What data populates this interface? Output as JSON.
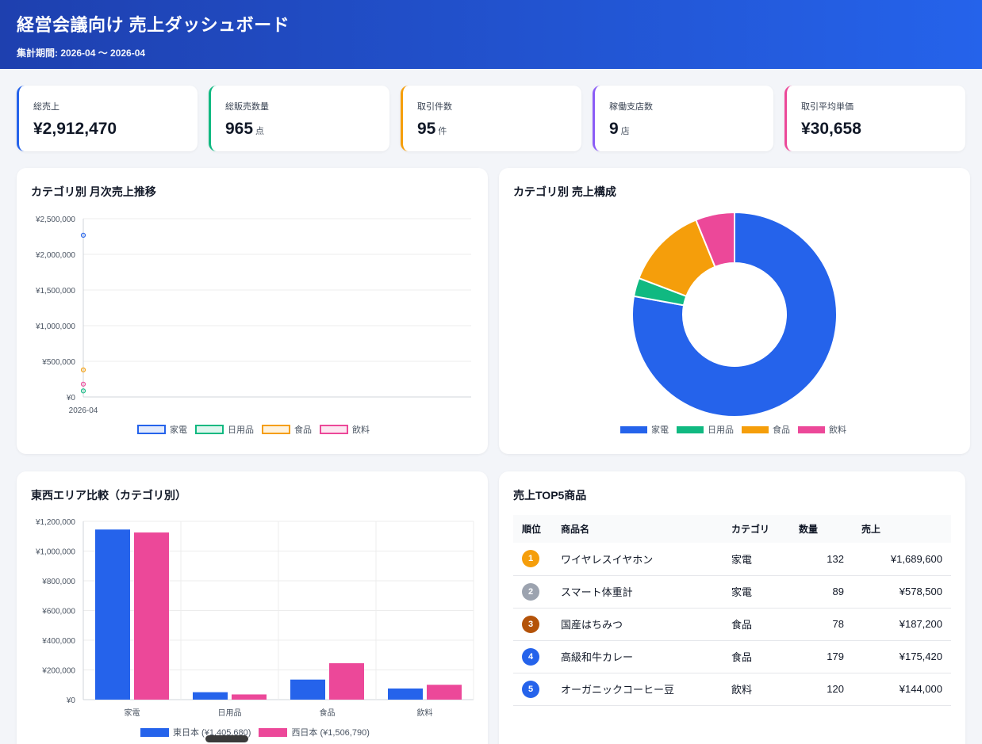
{
  "header": {
    "title": "経営会議向け 売上ダッシュボード",
    "period": "集計期間: 2026-04 〜 2026-04"
  },
  "kpis": [
    {
      "label": "総売上",
      "value": "¥2,912,470",
      "unit": "",
      "color": "#2563eb"
    },
    {
      "label": "総販売数量",
      "value": "965",
      "unit": "点",
      "color": "#10b981"
    },
    {
      "label": "取引件数",
      "value": "95",
      "unit": "件",
      "color": "#f59e0b"
    },
    {
      "label": "稼働支店数",
      "value": "9",
      "unit": "店",
      "color": "#8b5cf6"
    },
    {
      "label": "取引平均単価",
      "value": "¥30,658",
      "unit": "",
      "color": "#ec4899"
    }
  ],
  "colors": {
    "kaden": "#2563eb",
    "nichiyo": "#10b981",
    "shokuhin": "#f59e0b",
    "inryo": "#ec4899"
  },
  "line_card": {
    "title": "カテゴリ別 月次売上推移"
  },
  "donut_card": {
    "title": "カテゴリ別 売上構成"
  },
  "bar_card": {
    "title": "東西エリア比較（カテゴリ別）"
  },
  "top5_card": {
    "title": "売上TOP5商品",
    "columns": [
      "順位",
      "商品名",
      "カテゴリ",
      "数量",
      "売上"
    ],
    "rows": [
      {
        "rank": "1",
        "name": "ワイヤレスイヤホン",
        "category": "家電",
        "qty": "132",
        "sales": "¥1,689,600",
        "badge": "#f59e0b"
      },
      {
        "rank": "2",
        "name": "スマート体重計",
        "category": "家電",
        "qty": "89",
        "sales": "¥578,500",
        "badge": "#9ca3af"
      },
      {
        "rank": "3",
        "name": "国産はちみつ",
        "category": "食品",
        "qty": "78",
        "sales": "¥187,200",
        "badge": "#b45309"
      },
      {
        "rank": "4",
        "name": "高級和牛カレー",
        "category": "食品",
        "qty": "179",
        "sales": "¥175,420",
        "badge": "#2563eb"
      },
      {
        "rank": "5",
        "name": "オーガニックコーヒー豆",
        "category": "飲料",
        "qty": "120",
        "sales": "¥144,000",
        "badge": "#2563eb"
      }
    ]
  },
  "chart_data": [
    {
      "type": "line",
      "x": [
        "2026-04"
      ],
      "series": [
        {
          "name": "家電",
          "values": [
            2268000
          ],
          "color": "#2563eb"
        },
        {
          "name": "日用品",
          "values": [
            85000
          ],
          "color": "#10b981"
        },
        {
          "name": "食品",
          "values": [
            380000
          ],
          "color": "#f59e0b"
        },
        {
          "name": "飲料",
          "values": [
            180000
          ],
          "color": "#ec4899"
        }
      ],
      "ylim": [
        0,
        2500000
      ],
      "yticks": [
        "¥2,500,000",
        "¥2,000,000",
        "¥1,500,000",
        "¥1,000,000",
        "¥500,000",
        "¥0"
      ],
      "ytick_values": [
        2500000,
        2000000,
        1500000,
        1000000,
        500000,
        0
      ],
      "grid": true,
      "legend": "bottom"
    },
    {
      "type": "pie",
      "donut": true,
      "categories": [
        "家電",
        "日用品",
        "食品",
        "飲料"
      ],
      "values": [
        2268100,
        85000,
        380000,
        179370
      ],
      "colors": [
        "#2563eb",
        "#10b981",
        "#f59e0b",
        "#ec4899"
      ],
      "legend": "bottom"
    },
    {
      "type": "bar",
      "categories": [
        "家電",
        "日用品",
        "食品",
        "飲料"
      ],
      "series": [
        {
          "name": "東日本 (¥1,405,680)",
          "values": [
            1145000,
            50000,
            135000,
            75000
          ],
          "color": "#2563eb"
        },
        {
          "name": "西日本 (¥1,506,790)",
          "values": [
            1125000,
            35000,
            245000,
            100000
          ],
          "color": "#ec4899"
        }
      ],
      "ylim": [
        0,
        1200000
      ],
      "yticks": [
        "¥1,200,000",
        "¥1,000,000",
        "¥800,000",
        "¥600,000",
        "¥400,000",
        "¥200,000",
        "¥0"
      ],
      "ytick_values": [
        1200000,
        1000000,
        800000,
        600000,
        400000,
        200000,
        0
      ],
      "grid": true,
      "legend": "bottom"
    }
  ]
}
